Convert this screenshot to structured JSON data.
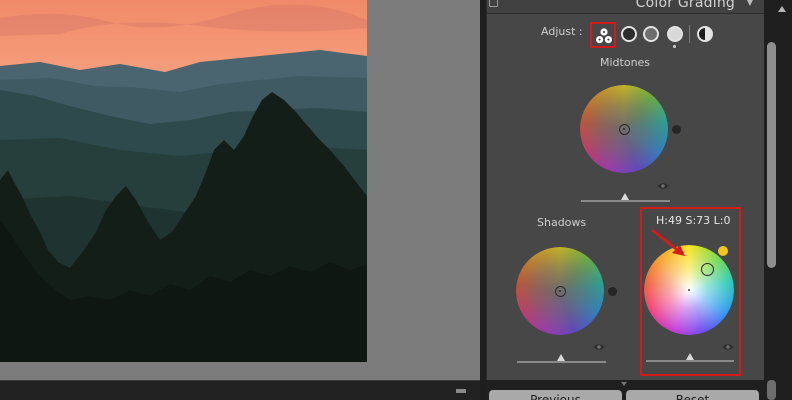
{
  "panel": {
    "title": "Color Grading",
    "header_arrow": "▼",
    "adjust_label": "Adjust :"
  },
  "wheels": {
    "midtones_label": "Midtones",
    "shadows_label": "Shadows",
    "highlights_readout": "H:49 S:73 L:0"
  },
  "buttons": {
    "previous_label": "Previous",
    "reset_label": "Reset"
  },
  "colors": {
    "annotation_red": "#d21b1b",
    "highlight_dot": "#f2c81b",
    "panel_bg": "#474747"
  },
  "icons": [
    "three-way-icon",
    "shadows-icon",
    "midtones-icon",
    "highlights-icon",
    "global-icon",
    "eye-icon",
    "collapse-arrow-icon"
  ]
}
